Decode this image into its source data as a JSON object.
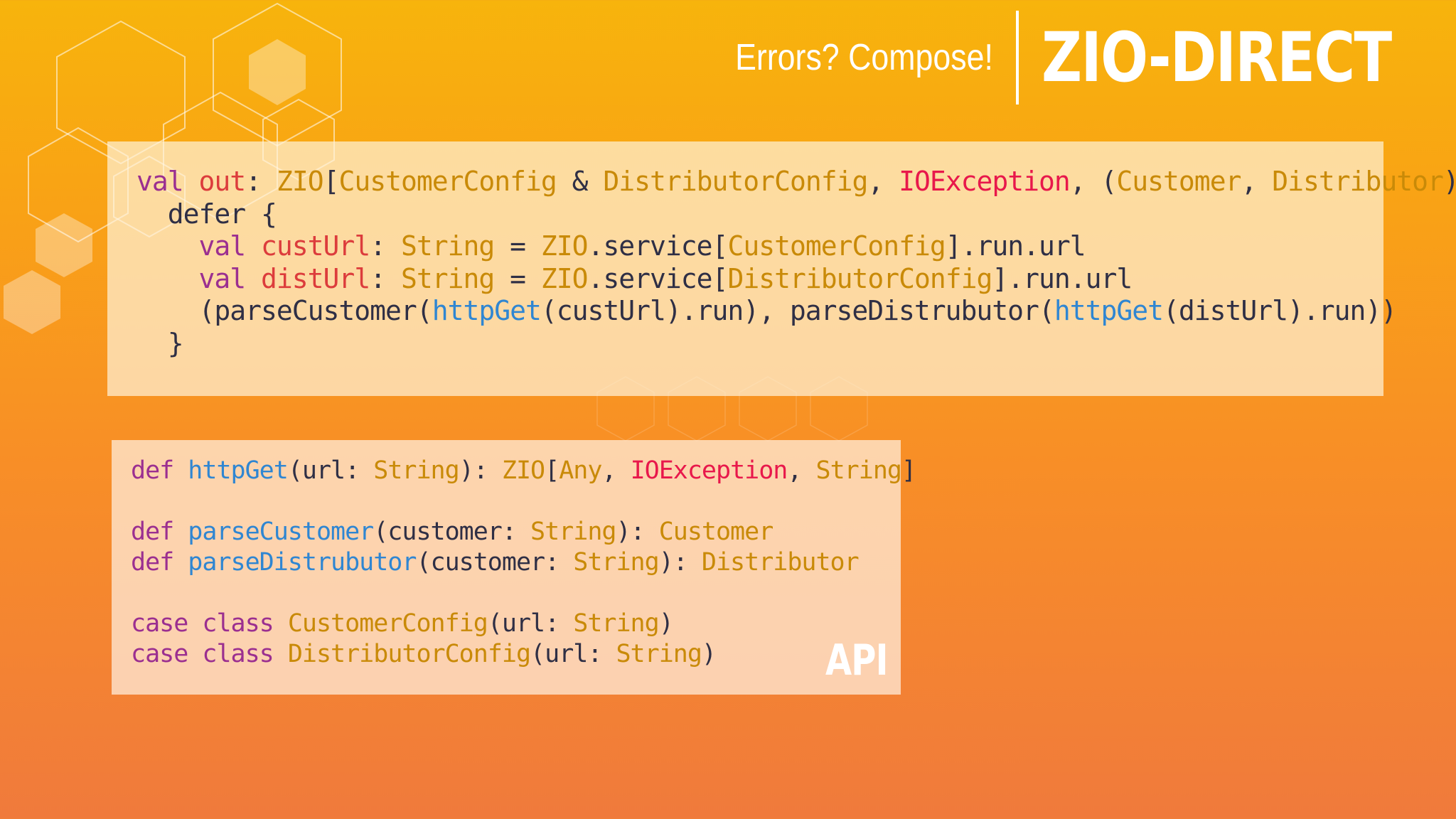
{
  "header": {
    "subtitle": "Errors? Compose!",
    "brand": "ZIO-DIRECT"
  },
  "colors": {
    "background_top": "#f7b40c",
    "background_bottom": "#f07a3c",
    "keyword": "#9b2f90",
    "variable": "#dc3c3c",
    "type": "#c98a08",
    "exception": "#e8184b",
    "function": "#2f86d2",
    "text": "#2f2f45"
  },
  "main_code": [
    [
      [
        "val",
        "k"
      ],
      [
        " ",
        "p"
      ],
      [
        "out",
        "v"
      ],
      [
        ": ",
        "p"
      ],
      [
        "ZIO",
        "t"
      ],
      [
        "[",
        "p"
      ],
      [
        "CustomerConfig",
        "t"
      ],
      [
        " & ",
        "p"
      ],
      [
        "DistributorConfig",
        "t"
      ],
      [
        ", ",
        "p"
      ],
      [
        "IOException",
        "e"
      ],
      [
        ", (",
        "p"
      ],
      [
        "Customer",
        "t"
      ],
      [
        ", ",
        "p"
      ],
      [
        "Distributor",
        "t"
      ],
      [
        ")] =",
        "p"
      ]
    ],
    [
      [
        "  defer {",
        "p"
      ]
    ],
    [
      [
        "    ",
        "p"
      ],
      [
        "val",
        "k"
      ],
      [
        " ",
        "p"
      ],
      [
        "custUrl",
        "v"
      ],
      [
        ": ",
        "p"
      ],
      [
        "String",
        "t"
      ],
      [
        " = ",
        "p"
      ],
      [
        "ZIO",
        "t"
      ],
      [
        ".service[",
        "p"
      ],
      [
        "CustomerConfig",
        "t"
      ],
      [
        "].run.url",
        "p"
      ]
    ],
    [
      [
        "    ",
        "p"
      ],
      [
        "val",
        "k"
      ],
      [
        " ",
        "p"
      ],
      [
        "distUrl",
        "v"
      ],
      [
        ": ",
        "p"
      ],
      [
        "String",
        "t"
      ],
      [
        " = ",
        "p"
      ],
      [
        "ZIO",
        "t"
      ],
      [
        ".service[",
        "p"
      ],
      [
        "DistributorConfig",
        "t"
      ],
      [
        "].run.url",
        "p"
      ]
    ],
    [
      [
        "    (parseCustomer(",
        "p"
      ],
      [
        "httpGet",
        "f"
      ],
      [
        "(custUrl).run), parseDistrubutor(",
        "p"
      ],
      [
        "httpGet",
        "f"
      ],
      [
        "(distUrl).run))",
        "p"
      ]
    ],
    [
      [
        "  }",
        "p"
      ]
    ]
  ],
  "api_code": [
    [
      [
        "def",
        "k"
      ],
      [
        " ",
        "p"
      ],
      [
        "httpGet",
        "f"
      ],
      [
        "(url: ",
        "p"
      ],
      [
        "String",
        "t"
      ],
      [
        "): ",
        "p"
      ],
      [
        "ZIO",
        "t"
      ],
      [
        "[",
        "p"
      ],
      [
        "Any",
        "t"
      ],
      [
        ", ",
        "p"
      ],
      [
        "IOException",
        "e"
      ],
      [
        ", ",
        "p"
      ],
      [
        "String",
        "t"
      ],
      [
        "]",
        "p"
      ]
    ],
    [
      [
        " ",
        "p"
      ]
    ],
    [
      [
        "def",
        "k"
      ],
      [
        " ",
        "p"
      ],
      [
        "parseCustomer",
        "f"
      ],
      [
        "(customer: ",
        "p"
      ],
      [
        "String",
        "t"
      ],
      [
        "): ",
        "p"
      ],
      [
        "Customer",
        "t"
      ]
    ],
    [
      [
        "def",
        "k"
      ],
      [
        " ",
        "p"
      ],
      [
        "parseDistrubutor",
        "f"
      ],
      [
        "(customer: ",
        "p"
      ],
      [
        "String",
        "t"
      ],
      [
        "): ",
        "p"
      ],
      [
        "Distributor",
        "t"
      ]
    ],
    [
      [
        " ",
        "p"
      ]
    ],
    [
      [
        "case",
        "k"
      ],
      [
        " ",
        "p"
      ],
      [
        "class",
        "k"
      ],
      [
        " ",
        "p"
      ],
      [
        "CustomerConfig",
        "t"
      ],
      [
        "(url: ",
        "p"
      ],
      [
        "String",
        "t"
      ],
      [
        ")",
        "p"
      ]
    ],
    [
      [
        "case",
        "k"
      ],
      [
        " ",
        "p"
      ],
      [
        "class",
        "k"
      ],
      [
        " ",
        "p"
      ],
      [
        "DistributorConfig",
        "t"
      ],
      [
        "(url: ",
        "p"
      ],
      [
        "String",
        "t"
      ],
      [
        ")",
        "p"
      ]
    ]
  ],
  "api_badge": "API"
}
